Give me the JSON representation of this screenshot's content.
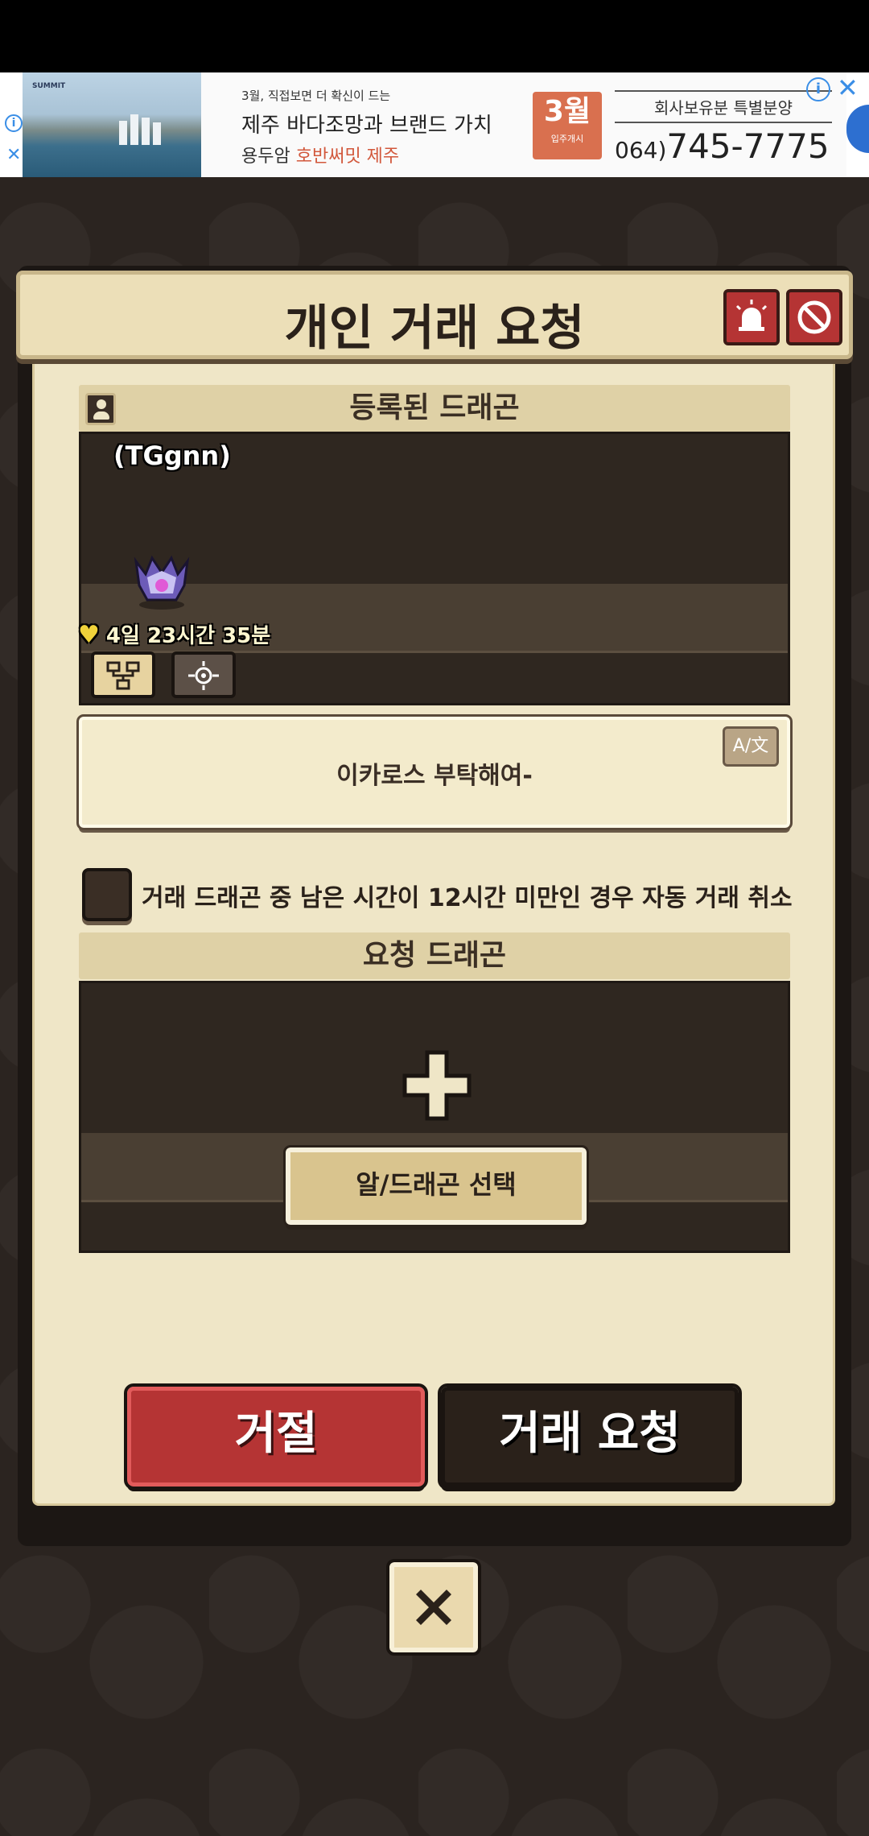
{
  "ad": {
    "small_text": "3월, 직접보면 더 확신이 드는",
    "headline": "제주 바다조망과 브랜드 가치",
    "sub_prefix": "용두암 ",
    "sub_highlight": "호반써밋 제주",
    "badge_month": "3월",
    "badge_sub": "입주개시",
    "right_top": "회사보유분 특별분양",
    "phone_prefix": "064)",
    "phone": "745-7775",
    "logo": "SUMMIT"
  },
  "dialog": {
    "title": "개인 거래 요청",
    "registered_header": "등록된 드래곤",
    "owner": "(TGgnn)",
    "timer": "4일 23시간 35분",
    "message": "이카로스 부탁해여-",
    "translate_label": "A/文",
    "auto_cancel_label": "거래 드래곤 중 남은 시간이 12시간 미만인 경우 자동 거래 취소",
    "auto_cancel_checked": false,
    "request_header": "요청 드래곤",
    "select_button": "알/드래곤 선택",
    "reject_button": "거절",
    "request_button": "거래 요청"
  },
  "colors": {
    "accent_red": "#b53434",
    "panel_bg": "#efe6c7",
    "dark": "#2a211a"
  }
}
